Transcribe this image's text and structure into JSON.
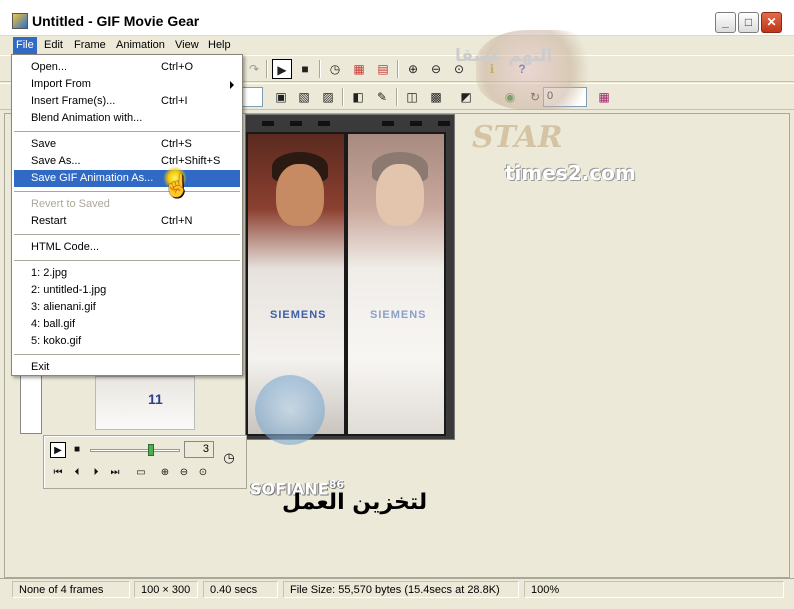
{
  "window": {
    "title": "Untitled - GIF Movie Gear"
  },
  "menubar": {
    "items": [
      "File",
      "Edit",
      "Frame",
      "Animation",
      "View",
      "Help"
    ]
  },
  "file_menu": {
    "items": [
      {
        "label": "Open...",
        "shortcut": "Ctrl+O"
      },
      {
        "label": "Import From",
        "shortcut": ""
      },
      {
        "label": "Insert Frame(s)...",
        "shortcut": "Ctrl+I"
      },
      {
        "label": "Blend Animation with...",
        "shortcut": ""
      },
      {
        "label": "Save",
        "shortcut": "Ctrl+S"
      },
      {
        "label": "Save As...",
        "shortcut": "Ctrl+Shift+S"
      },
      {
        "label": "Save GIF Animation As...",
        "shortcut": ""
      },
      {
        "label": "Revert to Saved",
        "shortcut": ""
      },
      {
        "label": "Restart",
        "shortcut": "Ctrl+N"
      },
      {
        "label": "HTML Code...",
        "shortcut": ""
      },
      {
        "label": "1: 2.jpg",
        "shortcut": ""
      },
      {
        "label": "2: untitled-1.jpg",
        "shortcut": ""
      },
      {
        "label": "3: alienani.gif",
        "shortcut": ""
      },
      {
        "label": "4: ball.gif",
        "shortcut": ""
      },
      {
        "label": "5: koko.gif",
        "shortcut": ""
      },
      {
        "label": "Exit",
        "shortcut": ""
      }
    ],
    "highlighted": "Save GIF Animation As...",
    "disabled": "Revert to Saved"
  },
  "toolbar2": {
    "frame_value": "0"
  },
  "frames": {
    "logo_text": "SIEMENS"
  },
  "preview": {
    "frame_number": "3",
    "preview_digit": "11"
  },
  "watermarks": {
    "star_text": "STAR",
    "site_text": "times2.com",
    "author_text": "SOFIANE",
    "author_sup": "86"
  },
  "caption": {
    "text": "لتخزين العمل"
  },
  "statusbar": {
    "frames": "None of 4 frames",
    "size": "100 × 300",
    "duration": "0.40 secs",
    "filesize": "File Size: 55,570 bytes  (15.4secs at 28.8K)",
    "zoom": "100%"
  },
  "colors": {
    "menu_highlight": "#316AC5",
    "close_button": "#C0361A",
    "window_bg": "#ECE9D8"
  }
}
